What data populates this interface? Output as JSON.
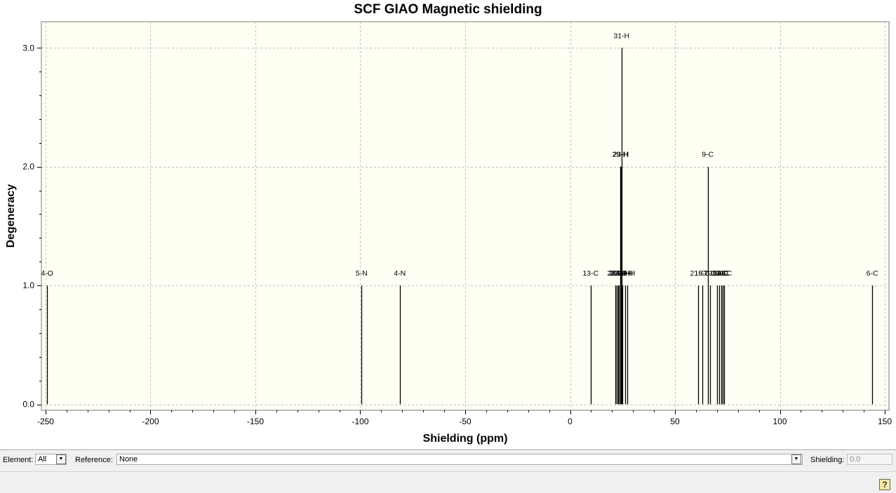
{
  "chart_data": {
    "type": "bar",
    "title": "SCF GIAO Magnetic shielding",
    "xlabel": "Shielding (ppm)",
    "ylabel": "Degeneracy",
    "xlim": [
      -252,
      152
    ],
    "ylim": [
      -0.05,
      3.22
    ],
    "x_ticks": [
      -250,
      -200,
      -150,
      -100,
      -50,
      0,
      50,
      100,
      150
    ],
    "y_ticks": [
      0.0,
      1.0,
      2.0,
      3.0
    ],
    "y_tick_labels": [
      "0.0",
      "1.0",
      "2.0",
      "3.0"
    ],
    "grid": true,
    "plot_background": "#fffff4",
    "series": [
      {
        "bars": [
          {
            "x": -249.3,
            "y": 1,
            "label": "4-O"
          },
          {
            "x": -99.4,
            "y": 1,
            "label": "5-N"
          },
          {
            "x": -81.2,
            "y": 1,
            "label": "4-N"
          },
          {
            "x": 9.8,
            "y": 1,
            "label": "13-C"
          },
          {
            "x": 21.5,
            "y": 1,
            "label": "28-H"
          },
          {
            "x": 22.3,
            "y": 1,
            "label": "26-H"
          },
          {
            "x": 22.9,
            "y": 1,
            "label": "27-H"
          },
          {
            "x": 23.4,
            "y": 1,
            "label": "24-H"
          },
          {
            "x": 23.9,
            "y": 2,
            "label": "29-H"
          },
          {
            "x": 24.2,
            "y": 2,
            "label": "23-H"
          },
          {
            "x": 24.5,
            "y": 3,
            "label": "31-H"
          },
          {
            "x": 25.0,
            "y": 1,
            "label": "22-H"
          },
          {
            "x": 26.2,
            "y": 1,
            "label": "20-H"
          },
          {
            "x": 27.2,
            "y": 1,
            "label": "19-H"
          },
          {
            "x": 61.0,
            "y": 1,
            "label": "21-C"
          },
          {
            "x": 63.0,
            "y": 1,
            "label": "15-C"
          },
          {
            "x": 65.6,
            "y": 2,
            "label": "9-C"
          },
          {
            "x": 66.8,
            "y": 1,
            "label": "7-C"
          },
          {
            "x": 70.1,
            "y": 1,
            "label": "16-C"
          },
          {
            "x": 71.2,
            "y": 1,
            "label": "10-C"
          },
          {
            "x": 72.0,
            "y": 1,
            "label": "14-C"
          },
          {
            "x": 72.8,
            "y": 1,
            "label": "8-C"
          },
          {
            "x": 73.5,
            "y": 1,
            "label": "11-C"
          },
          {
            "x": 144.0,
            "y": 1,
            "label": "6-C"
          }
        ]
      }
    ]
  },
  "controls": {
    "element_label": "Element:",
    "element_value": "All",
    "reference_label": "Reference:",
    "reference_value": "None",
    "shielding_label": "Shielding:",
    "shielding_value": "0.0"
  },
  "help_icon": "help-icon",
  "dropdown_icon": "dropdown-arrow-icon"
}
